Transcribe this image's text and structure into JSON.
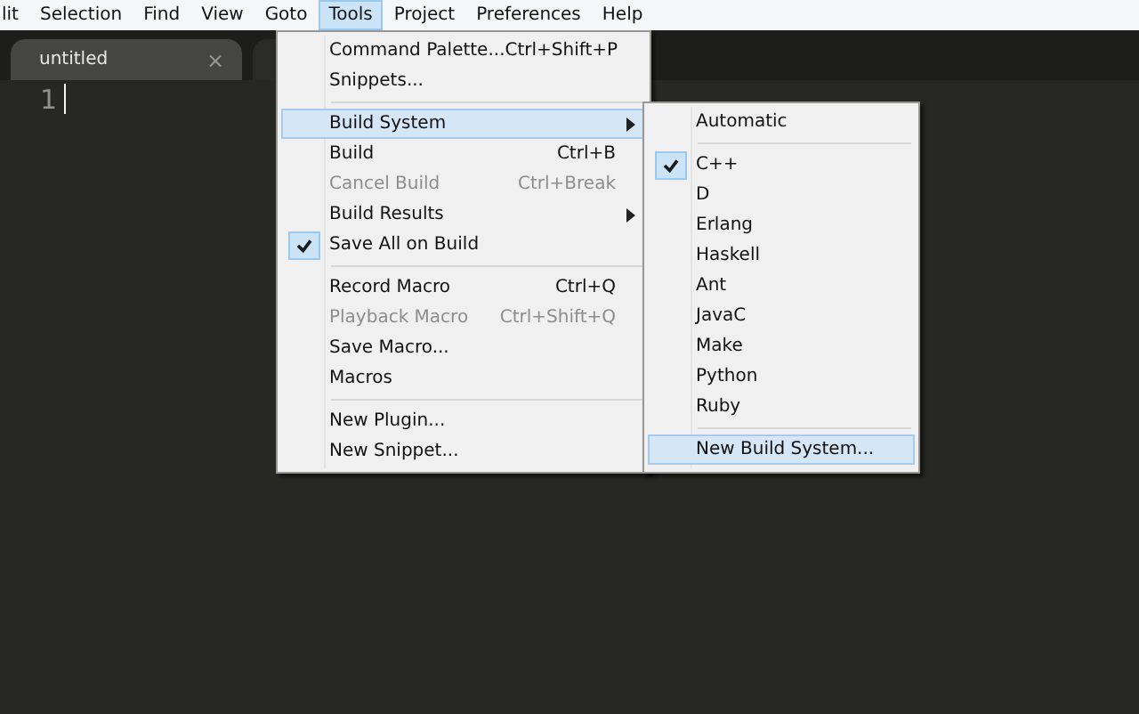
{
  "menubar": [
    {
      "label": "lit",
      "selected": false
    },
    {
      "label": "Selection",
      "selected": false
    },
    {
      "label": "Find",
      "selected": false
    },
    {
      "label": "View",
      "selected": false
    },
    {
      "label": "Goto",
      "selected": false
    },
    {
      "label": "Tools",
      "selected": true
    },
    {
      "label": "Project",
      "selected": false
    },
    {
      "label": "Preferences",
      "selected": false
    },
    {
      "label": "Help",
      "selected": false
    }
  ],
  "tabs": [
    {
      "label": "untitled",
      "close": "×",
      "selected": true
    },
    {
      "selected": false
    }
  ],
  "editor": {
    "line_number": "1"
  },
  "tools_menu": [
    {
      "kind": "item",
      "label": "Command Palette...",
      "shortcut": "Ctrl+Shift+P",
      "disabled": false,
      "checked": false,
      "selected": false,
      "submenu": false
    },
    {
      "kind": "item",
      "label": "Snippets...",
      "disabled": false,
      "checked": false,
      "selected": false,
      "submenu": false
    },
    {
      "kind": "separator"
    },
    {
      "kind": "item",
      "label": "Build System",
      "disabled": false,
      "checked": false,
      "selected": true,
      "submenu": true
    },
    {
      "kind": "item",
      "label": "Build",
      "shortcut": "Ctrl+B",
      "disabled": false,
      "checked": false,
      "selected": false,
      "submenu": false
    },
    {
      "kind": "item",
      "label": "Cancel Build",
      "shortcut": "Ctrl+Break",
      "disabled": true,
      "checked": false,
      "selected": false,
      "submenu": false
    },
    {
      "kind": "item",
      "label": "Build Results",
      "disabled": false,
      "checked": false,
      "selected": false,
      "submenu": true
    },
    {
      "kind": "item",
      "label": "Save All on Build",
      "disabled": false,
      "checked": true,
      "selected": false,
      "submenu": false
    },
    {
      "kind": "separator"
    },
    {
      "kind": "item",
      "label": "Record Macro",
      "shortcut": "Ctrl+Q",
      "disabled": false,
      "checked": false,
      "selected": false,
      "submenu": false
    },
    {
      "kind": "item",
      "label": "Playback Macro",
      "shortcut": "Ctrl+Shift+Q",
      "disabled": true,
      "checked": false,
      "selected": false,
      "submenu": false
    },
    {
      "kind": "item",
      "label": "Save Macro...",
      "disabled": false,
      "checked": false,
      "selected": false,
      "submenu": false
    },
    {
      "kind": "item",
      "label": "Macros",
      "disabled": false,
      "checked": false,
      "selected": false,
      "submenu": false
    },
    {
      "kind": "separator"
    },
    {
      "kind": "item",
      "label": "New Plugin...",
      "disabled": false,
      "checked": false,
      "selected": false,
      "submenu": false
    },
    {
      "kind": "item",
      "label": "New Snippet...",
      "disabled": false,
      "checked": false,
      "selected": false,
      "submenu": false
    }
  ],
  "build_system_menu": [
    {
      "kind": "item",
      "label": "Automatic",
      "checked": false,
      "selected": false
    },
    {
      "kind": "separator"
    },
    {
      "kind": "item",
      "label": "C++",
      "checked": true,
      "selected": false
    },
    {
      "kind": "item",
      "label": "D",
      "checked": false,
      "selected": false
    },
    {
      "kind": "item",
      "label": "Erlang",
      "checked": false,
      "selected": false
    },
    {
      "kind": "item",
      "label": "Haskell",
      "checked": false,
      "selected": false
    },
    {
      "kind": "item",
      "label": "Ant",
      "checked": false,
      "selected": false
    },
    {
      "kind": "item",
      "label": "JavaC",
      "checked": false,
      "selected": false
    },
    {
      "kind": "item",
      "label": "Make",
      "checked": false,
      "selected": false
    },
    {
      "kind": "item",
      "label": "Python",
      "checked": false,
      "selected": false
    },
    {
      "kind": "item",
      "label": "Ruby",
      "checked": false,
      "selected": false
    },
    {
      "kind": "separator"
    },
    {
      "kind": "item",
      "label": "New Build System...",
      "checked": false,
      "selected": true
    }
  ]
}
